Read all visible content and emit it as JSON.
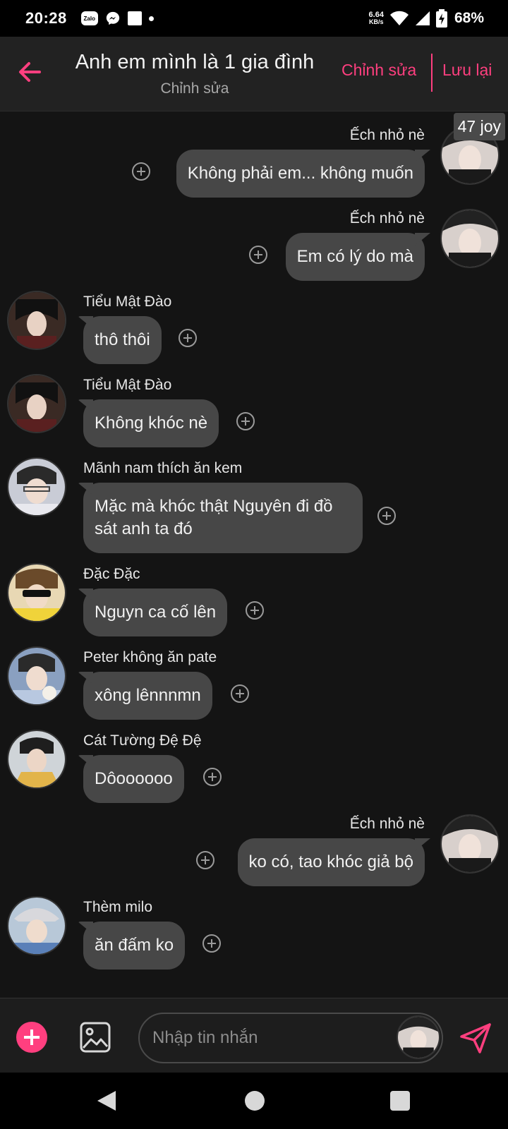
{
  "status_bar": {
    "time": "20:28",
    "notifications": [
      "zalo-icon",
      "messenger-icon",
      "square-icon",
      "dot-icon"
    ],
    "zalo_text": "Zalo",
    "net_speed": "6.64",
    "net_unit": "KB/s",
    "battery": "68%"
  },
  "header": {
    "title": "Anh em mình là 1 gia đình",
    "subtitle": "Chỉnh sửa",
    "edit_label": "Chỉnh sửa",
    "save_label": "Lưu lại",
    "accent_color": "#ff3f7f"
  },
  "badge": {
    "text": "47 joy"
  },
  "messages": [
    {
      "sender": "Ếch nhỏ nè",
      "text": "Không phải em... không muốn",
      "direction": "out"
    },
    {
      "sender": "Ếch nhỏ nè",
      "text": "Em có lý do mà",
      "direction": "out"
    },
    {
      "sender": "Tiểu Mật Đào",
      "text": "thô thôi",
      "direction": "in"
    },
    {
      "sender": "Tiểu Mật Đào",
      "text": "Không khóc nè",
      "direction": "in"
    },
    {
      "sender": "Mãnh nam thích ăn kem",
      "text": "Mặc mà khóc thật Nguyên đi đồ sát anh ta đó",
      "direction": "in"
    },
    {
      "sender": "Đặc Đặc",
      "text": "Nguyn ca cố lên",
      "direction": "in"
    },
    {
      "sender": "Peter không ăn pate",
      "text": "xông lênnnmn",
      "direction": "in"
    },
    {
      "sender": "Cát Tường Đệ Đệ",
      "text": "Dôoooooo",
      "direction": "in"
    },
    {
      "sender": "Ếch nhỏ nè",
      "text": "ko có, tao khóc giả bộ",
      "direction": "out"
    },
    {
      "sender": "Thèm milo",
      "text": "ăn đấm ko",
      "direction": "in"
    }
  ],
  "input": {
    "placeholder": "Nhập tin nhắn"
  }
}
